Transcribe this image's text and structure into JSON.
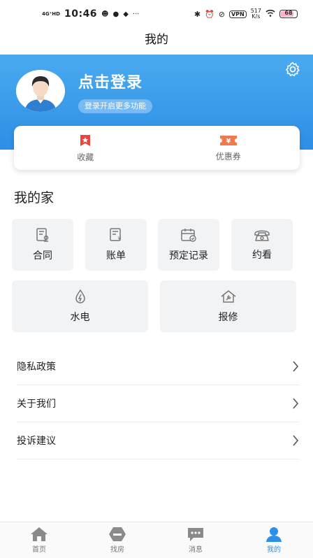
{
  "status_bar": {
    "network": "4G⁺HD",
    "time": "10:46",
    "vpn": "VPN",
    "speed_value": "517",
    "speed_unit": "K/s",
    "battery": "68"
  },
  "page_title": "我的",
  "profile": {
    "login_title": "点击登录",
    "login_subtitle": "登录开启更多功能",
    "settings_icon": "gear-icon"
  },
  "quick_actions": [
    {
      "label": "收藏",
      "icon": "bookmark-icon",
      "color": "#e8453c"
    },
    {
      "label": "优惠券",
      "icon": "coupon-icon",
      "color": "#f07a4a"
    }
  ],
  "my_home": {
    "title": "我的家",
    "items": [
      {
        "label": "合同",
        "icon": "contract-icon"
      },
      {
        "label": "账单",
        "icon": "bill-icon"
      },
      {
        "label": "预定记录",
        "icon": "calendar-icon"
      },
      {
        "label": "约看",
        "icon": "phone-icon"
      },
      {
        "label": "水电",
        "icon": "utilities-icon"
      },
      {
        "label": "报修",
        "icon": "repair-icon"
      }
    ]
  },
  "menu": [
    {
      "label": "隐私政策"
    },
    {
      "label": "关于我们"
    },
    {
      "label": "投诉建议"
    }
  ],
  "tabs": [
    {
      "label": "首页",
      "icon": "home-icon",
      "active": false
    },
    {
      "label": "找房",
      "icon": "find-house-icon",
      "active": false
    },
    {
      "label": "消息",
      "icon": "message-icon",
      "active": false
    },
    {
      "label": "我的",
      "icon": "profile-icon",
      "active": true
    }
  ],
  "colors": {
    "accent": "#2d8fe6",
    "hero_top": "#4aaaf0",
    "card_bg": "#f2f3f5"
  }
}
